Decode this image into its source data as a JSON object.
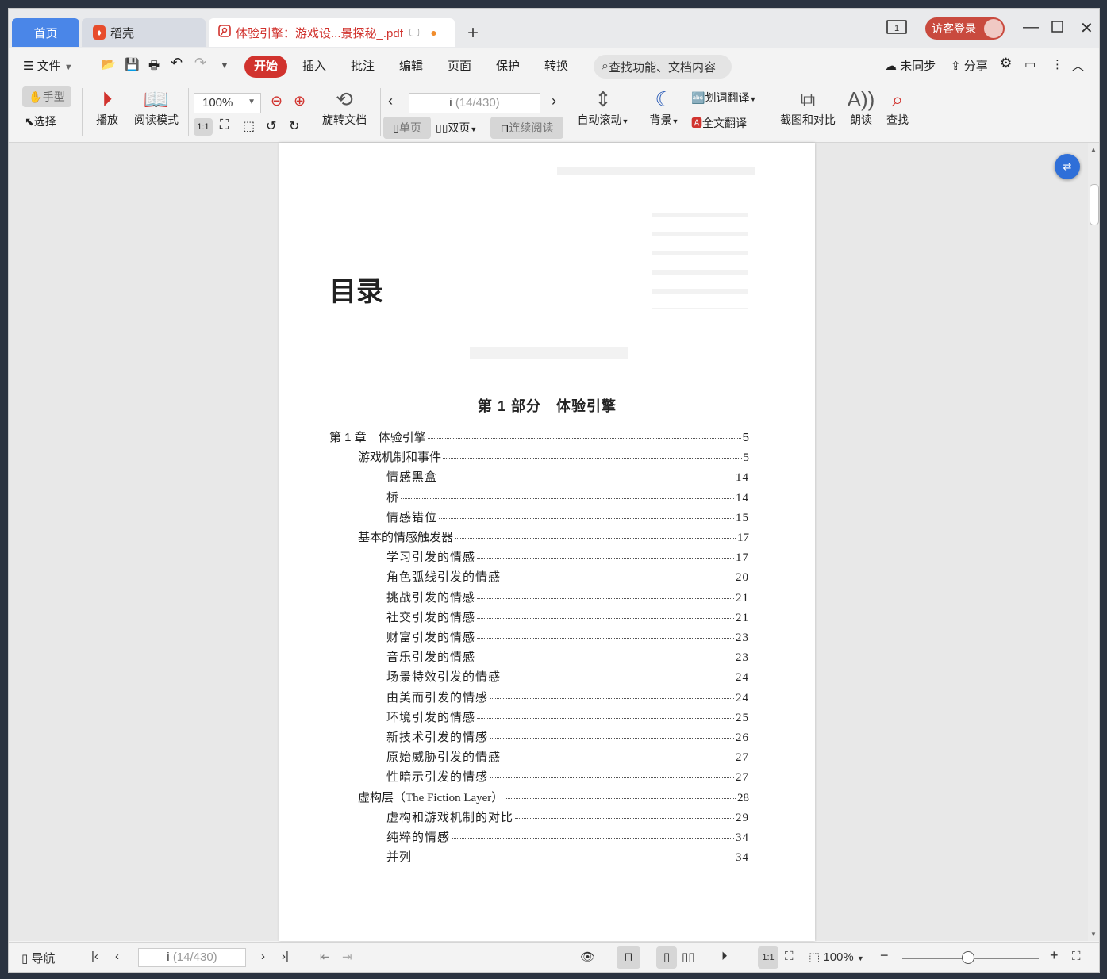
{
  "tabs": {
    "home": "首页",
    "daoke": "稻壳",
    "doc_title": "体验引擎：游戏设...景探秘_.pdf",
    "new_tab": "+"
  },
  "topbar": {
    "layout_num": "1",
    "visitor_login": "访客登录"
  },
  "menu": {
    "file": "文件",
    "items": [
      "开始",
      "插入",
      "批注",
      "编辑",
      "页面",
      "保护",
      "转换"
    ],
    "search_placeholder": "查找功能、文档内容",
    "sync": "未同步",
    "share": "分享"
  },
  "ribbon": {
    "hand": "手型",
    "select": "选择",
    "play": "播放",
    "read_mode": "阅读模式",
    "zoom": "100%",
    "rotate": "旋转文档",
    "page_current": "i",
    "page_total": "(14/430)",
    "single": "单页",
    "double": "双页",
    "continuous": "连续阅读",
    "auto_scroll": "自动滚动",
    "background": "背景",
    "word_translate": "划词翻译",
    "full_translate": "全文翻译",
    "screenshot": "截图和对比",
    "read_aloud": "朗读",
    "find": "查找"
  },
  "document": {
    "title": "目录",
    "part": "第 1 部分　体验引擎",
    "toc": [
      {
        "level": 0,
        "text": "第 1 章　体验引擎",
        "page": "5"
      },
      {
        "level": 1,
        "text": "游戏机制和事件",
        "page": "5"
      },
      {
        "level": 2,
        "text": "情感黑盒",
        "page": "14"
      },
      {
        "level": 2,
        "text": "桥",
        "page": "14"
      },
      {
        "level": 2,
        "text": "情感错位",
        "page": "15"
      },
      {
        "level": 1,
        "text": "基本的情感触发器",
        "page": "17"
      },
      {
        "level": 2,
        "text": "学习引发的情感",
        "page": "17"
      },
      {
        "level": 2,
        "text": "角色弧线引发的情感",
        "page": "20"
      },
      {
        "level": 2,
        "text": "挑战引发的情感",
        "page": "21"
      },
      {
        "level": 2,
        "text": "社交引发的情感",
        "page": "21"
      },
      {
        "level": 2,
        "text": "财富引发的情感",
        "page": "23"
      },
      {
        "level": 2,
        "text": "音乐引发的情感",
        "page": "23"
      },
      {
        "level": 2,
        "text": "场景特效引发的情感",
        "page": "24"
      },
      {
        "level": 2,
        "text": "由美而引发的情感",
        "page": "24"
      },
      {
        "level": 2,
        "text": "环境引发的情感",
        "page": "25"
      },
      {
        "level": 2,
        "text": "新技术引发的情感",
        "page": "26"
      },
      {
        "level": 2,
        "text": "原始威胁引发的情感",
        "page": "27"
      },
      {
        "level": 2,
        "text": "性暗示引发的情感",
        "page": "27"
      },
      {
        "level": 1,
        "text": "虚构层（The Fiction Layer）",
        "page": "28"
      },
      {
        "level": 2,
        "text": "虚构和游戏机制的对比",
        "page": "29"
      },
      {
        "level": 2,
        "text": "纯粹的情感",
        "page": "34"
      },
      {
        "level": 2,
        "text": "并列",
        "page": "34"
      }
    ]
  },
  "statusbar": {
    "nav": "导航",
    "page_current": "i",
    "page_total": "(14/430)",
    "zoom": "100%"
  },
  "colors": {
    "accent_red": "#d1332e",
    "home_blue": "#4a86e8"
  }
}
